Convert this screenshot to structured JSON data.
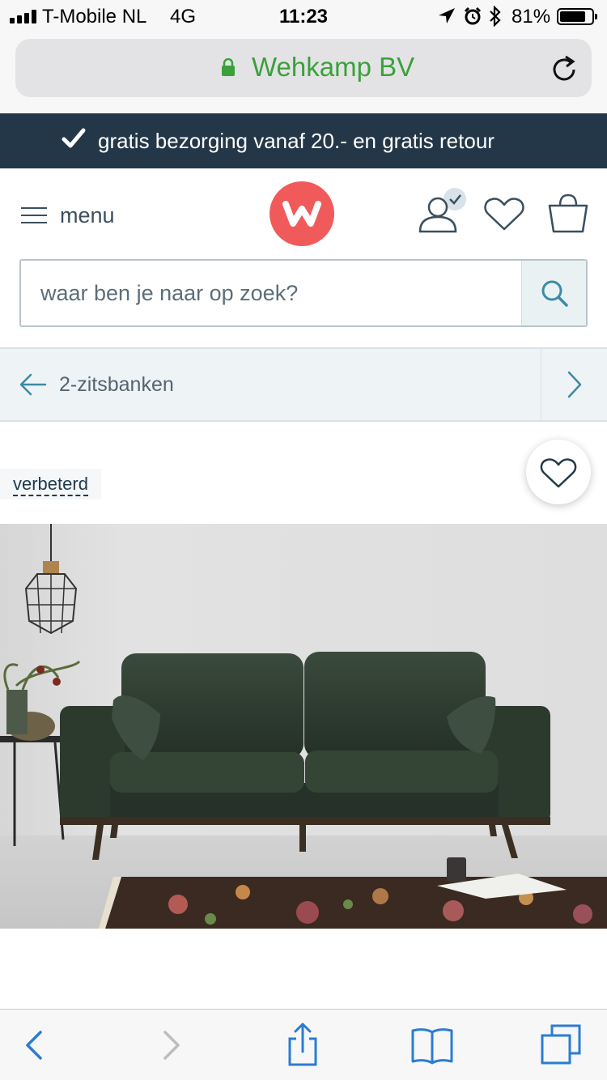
{
  "status_bar": {
    "carrier": "T-Mobile NL",
    "network": "4G",
    "time": "11:23",
    "battery": "81%",
    "battery_level": 0.81
  },
  "browser": {
    "domain": "Wehkamp BV"
  },
  "promo": {
    "text": "gratis bezorging vanaf 20.- en gratis retour"
  },
  "header": {
    "menu_label": "menu",
    "search_placeholder": "waar ben je naar op zoek?"
  },
  "breadcrumb": {
    "label": "2-zitsbanken"
  },
  "product": {
    "badge": "verbeterd"
  },
  "colors": {
    "brand": "#f05a5b",
    "banner": "#233748",
    "accent": "#3d8aa6",
    "lock_green": "#3aa13a",
    "ios_blue": "#2b7cd3"
  },
  "icons": [
    "signal-icon",
    "location-icon",
    "alarm-icon",
    "bluetooth-icon",
    "battery-icon",
    "lock-icon",
    "reload-icon",
    "check-icon",
    "hamburger-icon",
    "wehkamp-logo",
    "account-icon",
    "heart-icon",
    "bag-icon",
    "search-icon",
    "arrow-left-icon",
    "chevron-right-icon",
    "back-icon",
    "forward-icon",
    "share-icon",
    "bookmarks-icon",
    "tabs-icon"
  ]
}
